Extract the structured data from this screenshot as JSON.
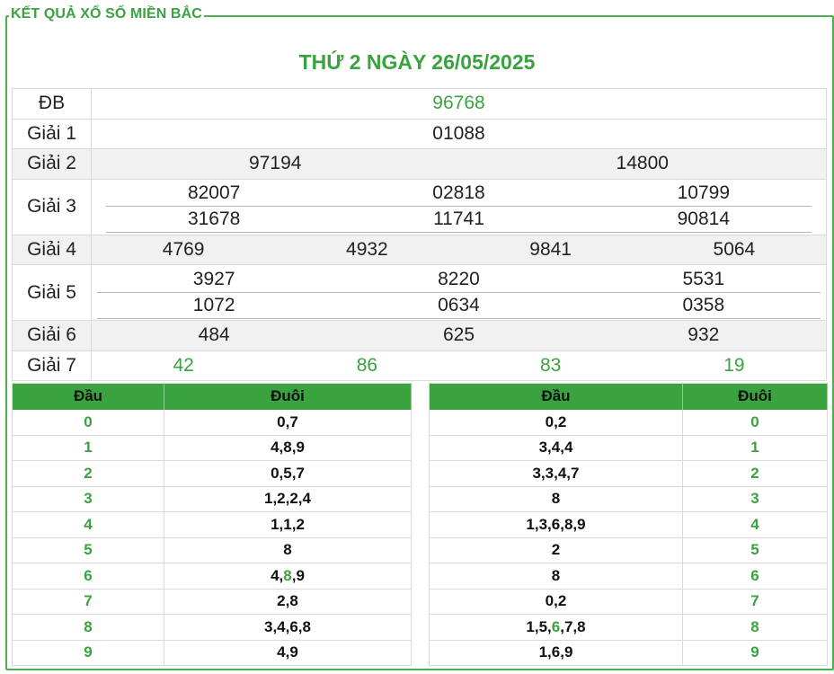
{
  "legend": "KẾT QUẢ XỔ SỐ MIỀN BẮC",
  "headline": "THỨ 2 NGÀY 26/05/2025",
  "prizes": {
    "db": {
      "label": "ĐB",
      "values": [
        "96768"
      ]
    },
    "g1": {
      "label": "Giải 1",
      "values": [
        "01088"
      ]
    },
    "g2": {
      "label": "Giải 2",
      "values": [
        "97194",
        "14800"
      ]
    },
    "g3": {
      "label": "Giải 3",
      "values": [
        "82007",
        "02818",
        "10799",
        "31678",
        "11741",
        "90814"
      ]
    },
    "g4": {
      "label": "Giải 4",
      "values": [
        "4769",
        "4932",
        "9841",
        "5064"
      ]
    },
    "g5": {
      "label": "Giải 5",
      "values": [
        "3927",
        "8220",
        "5531",
        "1072",
        "0634",
        "0358"
      ]
    },
    "g6": {
      "label": "Giải 6",
      "values": [
        "484",
        "625",
        "932"
      ]
    },
    "g7": {
      "label": "Giải 7",
      "values": [
        "42",
        "86",
        "83",
        "19"
      ]
    }
  },
  "loto_left": {
    "headers": [
      "Đầu",
      "Đuôi"
    ],
    "rows": [
      {
        "key": "0",
        "val": "0,7"
      },
      {
        "key": "1",
        "val": "4,8,9"
      },
      {
        "key": "2",
        "val": "0,5,7"
      },
      {
        "key": "3",
        "val": "1,2,2,4"
      },
      {
        "key": "4",
        "val": "1,1,2"
      },
      {
        "key": "5",
        "val": "8"
      },
      {
        "key": "6",
        "val_pre": "4,",
        "val_hl": "8",
        "val_post": ",9"
      },
      {
        "key": "7",
        "val": "2,8"
      },
      {
        "key": "8",
        "val": "3,4,6,8"
      },
      {
        "key": "9",
        "val": "4,9"
      }
    ]
  },
  "loto_right": {
    "headers": [
      "Đầu",
      "Đuôi"
    ],
    "rows": [
      {
        "key": "0",
        "val": "0,2"
      },
      {
        "key": "1",
        "val": "3,4,4"
      },
      {
        "key": "2",
        "val": "3,3,4,7"
      },
      {
        "key": "3",
        "val": "8"
      },
      {
        "key": "4",
        "val": "1,3,6,8,9"
      },
      {
        "key": "5",
        "val": "2"
      },
      {
        "key": "6",
        "val": "8"
      },
      {
        "key": "7",
        "val": "0,2"
      },
      {
        "key": "8",
        "val_pre": "1,5,",
        "val_hl": "6",
        "val_post": ",7,8"
      },
      {
        "key": "9",
        "val": "1,6,9"
      }
    ]
  },
  "colors": {
    "accent": "#3aa23f",
    "border": "#4caf50",
    "row_gray": "#f1f1f1"
  }
}
